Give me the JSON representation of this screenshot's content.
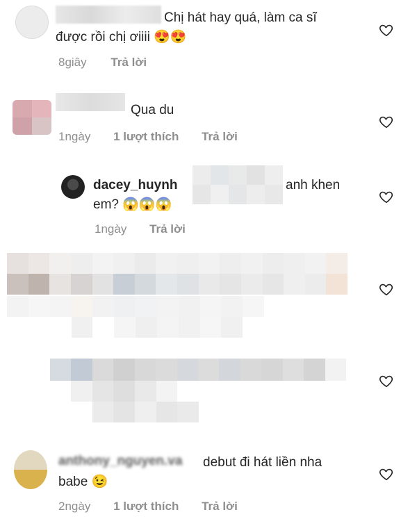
{
  "comments": [
    {
      "text": "Chị hát hay quá, làm ca sĩ",
      "text2": "được rồi chị ơiiii",
      "emoji": [
        "😍",
        "😍"
      ],
      "time": "8giây",
      "reply": "Trả lời"
    },
    {
      "text": "Qua du",
      "time": "1ngày",
      "likes": "1 lượt thích",
      "reply": "Trả lời"
    },
    {
      "username": "dacey_huynh",
      "text_tail": "anh khen",
      "text2": "em?",
      "emoji": [
        "😱",
        "😱",
        "😱"
      ],
      "time": "1ngày",
      "reply": "Trả lời"
    },
    {
      "username_partial": "anthony_nguyen.va",
      "text": "debut đi hát liền nha",
      "text2": "babe",
      "emoji": [
        "😉"
      ],
      "time": "2ngày",
      "likes": "1 lượt thích",
      "reply": "Trả lời"
    }
  ],
  "icons": {
    "like": "heart-outline-icon"
  },
  "colors": {
    "text": "#262626",
    "meta": "#8e8e8e",
    "heart": "#262626"
  }
}
